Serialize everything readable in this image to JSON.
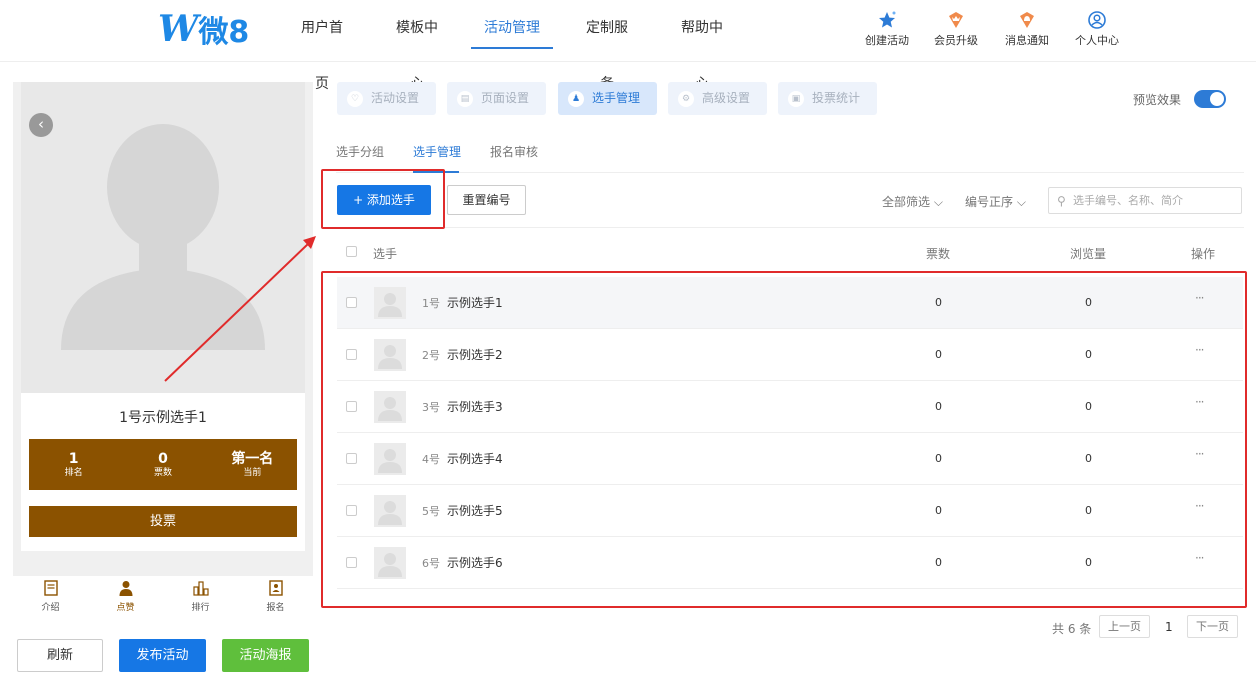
{
  "logo": {
    "mark": "W",
    "text": "微8"
  },
  "nav": [
    {
      "label": "用户首页"
    },
    {
      "label": "模板中心"
    },
    {
      "label": "活动管理"
    },
    {
      "label": "定制服务"
    },
    {
      "label": "帮助中心"
    }
  ],
  "top_icons": [
    {
      "label": "创建活动",
      "icon": "star-icon"
    },
    {
      "label": "会员升级",
      "icon": "crown-badge-icon"
    },
    {
      "label": "消息通知",
      "icon": "bell-badge-icon"
    },
    {
      "label": "个人中心",
      "icon": "user-circle-icon"
    }
  ],
  "preview": {
    "player_title": "1号示例选手1",
    "stats": [
      {
        "value": "1",
        "label": "排名"
      },
      {
        "value": "0",
        "label": "票数"
      },
      {
        "value": "第一名",
        "label": "当前"
      }
    ],
    "vote_button": "投票",
    "tabs": [
      {
        "label": "介绍",
        "icon": "document-icon"
      },
      {
        "label": "点赞",
        "icon": "person-icon"
      },
      {
        "label": "排行",
        "icon": "bar-chart-icon"
      },
      {
        "label": "报名",
        "icon": "id-card-icon"
      }
    ]
  },
  "actions": {
    "refresh": "刷新",
    "publish": "发布活动",
    "poster": "活动海报"
  },
  "steps": [
    {
      "label": "活动设置",
      "icon": "heart-icon"
    },
    {
      "label": "页面设置",
      "icon": "page-icon"
    },
    {
      "label": "选手管理",
      "icon": "contestant-icon"
    },
    {
      "label": "高级设置",
      "icon": "settings-icon"
    },
    {
      "label": "投票统计",
      "icon": "stats-icon"
    }
  ],
  "preview_toggle": {
    "label": "预览效果",
    "on": true
  },
  "subtabs": [
    {
      "label": "选手分组"
    },
    {
      "label": "选手管理"
    },
    {
      "label": "报名审核"
    }
  ],
  "toolbar": {
    "add_label": "+ 添加选手",
    "reset_label": "重置编号",
    "filter_all": "全部筛选 ⌵",
    "sort": "编号正序 ⌵",
    "search_placeholder": "选手编号、名称、简介"
  },
  "table": {
    "headers": {
      "player": "选手",
      "votes": "票数",
      "views": "浏览量",
      "ops": "操作"
    },
    "rows": [
      {
        "num": "1号",
        "name": "示例选手1",
        "votes": "0",
        "views": "0",
        "op": "···"
      },
      {
        "num": "2号",
        "name": "示例选手2",
        "votes": "0",
        "views": "0",
        "op": "···"
      },
      {
        "num": "3号",
        "name": "示例选手3",
        "votes": "0",
        "views": "0",
        "op": "···"
      },
      {
        "num": "4号",
        "name": "示例选手4",
        "votes": "0",
        "views": "0",
        "op": "···"
      },
      {
        "num": "5号",
        "name": "示例选手5",
        "votes": "0",
        "views": "0",
        "op": "···"
      },
      {
        "num": "6号",
        "name": "示例选手6",
        "votes": "0",
        "views": "0",
        "op": "···"
      }
    ]
  },
  "pager": {
    "total": "共 6 条",
    "prev": "上一页",
    "current": "1",
    "next": "下一页"
  },
  "colors": {
    "accent": "#2d7bd6",
    "primary_button": "#1677e5",
    "brown": "#8b5200",
    "green": "#5fbf3c",
    "annotation": "#e02b2b"
  }
}
